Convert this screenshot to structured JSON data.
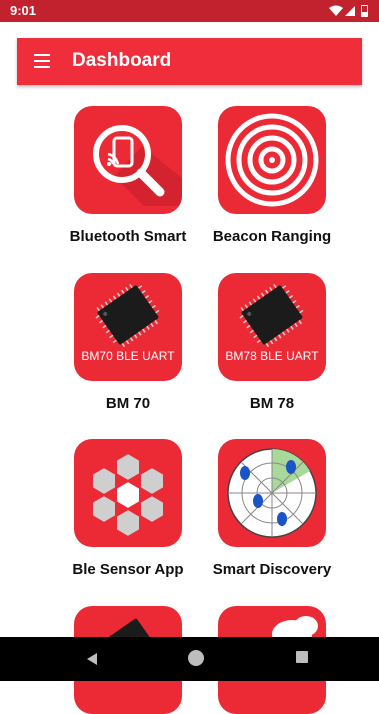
{
  "status_bar": {
    "time": "9:01",
    "icons": [
      "wifi-icon",
      "signal-icon",
      "battery-icon"
    ]
  },
  "toolbar": {
    "title": "Dashboard",
    "menu_icon": "hamburger-menu-icon"
  },
  "tiles": [
    {
      "label": "Bluetooth Smart",
      "icon": "bluetooth-smart-search-icon"
    },
    {
      "label": "Beacon Ranging",
      "icon": "beacon-ranging-rings-icon"
    },
    {
      "label": "BM 70",
      "icon": "chip-icon",
      "caption": "BM70 BLE UART"
    },
    {
      "label": "BM 78",
      "icon": "chip-icon",
      "caption": "BM78 BLE UART"
    },
    {
      "label": "Ble Sensor App",
      "icon": "hexagon-sensor-icon"
    },
    {
      "label": "Smart Discovery",
      "icon": "radar-discovery-icon"
    }
  ],
  "colors": {
    "status_bar": "#c2212e",
    "toolbar": "#ef2d3b",
    "tile": "#ec2a36",
    "nav_bar": "#000000"
  },
  "nav": {
    "icons": [
      "back-icon",
      "home-icon",
      "recents-icon"
    ]
  }
}
